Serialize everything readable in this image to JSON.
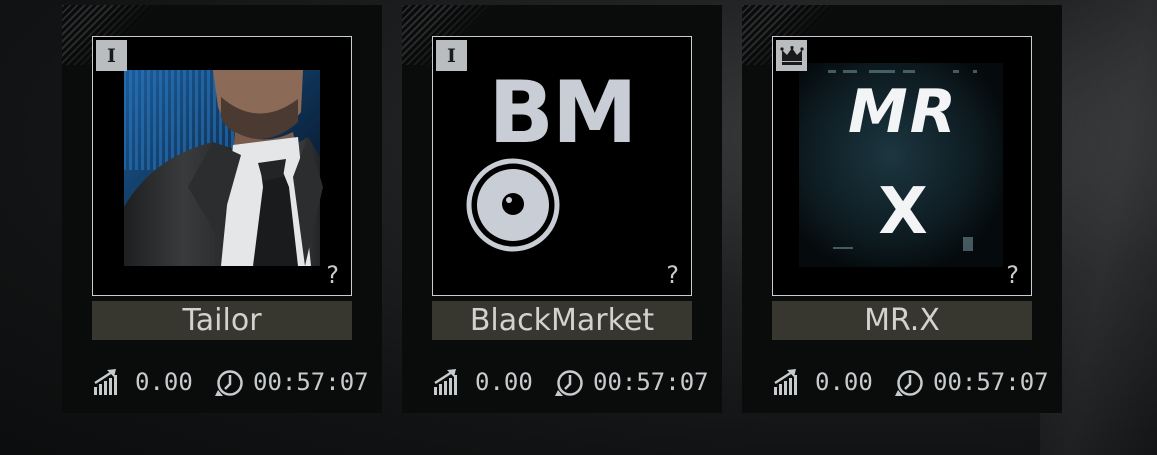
{
  "traders": [
    {
      "name": "Tailor",
      "badge": "I",
      "badge_type": "roman-numeral",
      "unknown_mark": "?",
      "level_value": "0.00",
      "timer": "00:57:07",
      "portrait": "man-in-suit"
    },
    {
      "name": "BlackMarket",
      "badge": "I",
      "badge_type": "roman-numeral",
      "unknown_mark": "?",
      "level_value": "0.00",
      "timer": "00:57:07",
      "portrait": "bm-logo",
      "logo_text": "BM"
    },
    {
      "name": "MR.X",
      "badge": "",
      "badge_type": "crown-icon",
      "unknown_mark": "?",
      "level_value": "0.00",
      "timer": "00:57:07",
      "portrait": "mrx-logo",
      "logo_lines": [
        "MR",
        "X"
      ]
    }
  ],
  "colors": {
    "card": "#0a0b0b",
    "namebar": "#37372f",
    "text": "#d2d3cc",
    "frame": "#c9cdd0"
  },
  "icons": {
    "level": "standing-icon",
    "timer": "clock-icon"
  }
}
